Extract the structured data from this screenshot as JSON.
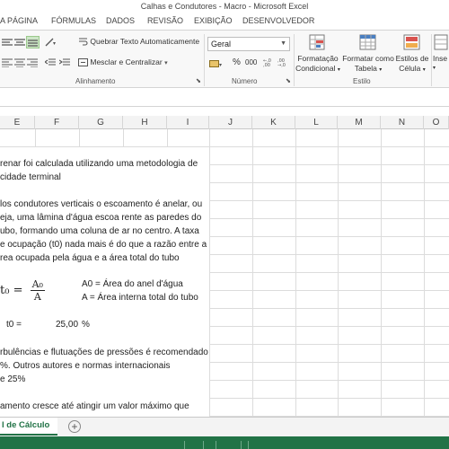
{
  "window": {
    "title": "Calhas e Condutores - Macro - Microsoft Excel"
  },
  "ribbon_tabs": [
    "A PÁGINA",
    "FÓRMULAS",
    "DADOS",
    "REVISÃO",
    "EXIBIÇÃO",
    "DESENVOLVEDOR"
  ],
  "ribbon": {
    "wrap_text_label": "Quebrar Texto Automaticamente",
    "merge_label": "Mesclar e Centralizar",
    "number_format_value": "Geral",
    "percent_symbol": "%",
    "thousands_symbol": "000",
    "conditional_format_label_1": "Formatação",
    "conditional_format_label_2": "Condicional",
    "format_table_label_1": "Formatar como",
    "format_table_label_2": "Tabela",
    "cell_styles_label_1": "Estilos de",
    "cell_styles_label_2": "Célula",
    "insert_label": "Inse",
    "group_alignment": "Alinhamento",
    "group_number": "Número",
    "group_style": "Estilo"
  },
  "columns": [
    "E",
    "F",
    "G",
    "H",
    "I",
    "J",
    "K",
    "L",
    "M",
    "N",
    "O"
  ],
  "cells": {
    "r1": "renar foi calculada utilizando uma metodologia de",
    "r2": "cidade terminal",
    "r3": "los condutores verticais o escoamento é anelar, ou",
    "r4": "eja, uma lâmina d'água escoa rente as paredes do",
    "r5": "ubo, formando uma coluna de ar no centro. A taxa",
    "r6": "e ocupação (t0) nada mais é do que a razão entre a",
    "r7": "rea ocupada pela água e a área total do tubo",
    "formula_lhs": "t₀ =",
    "formula_num": "A₀",
    "formula_den": "A",
    "def1": "A0 = Área do anel d'água",
    "def2": "A = Área interna total do tubo",
    "t0_label": "t0 =",
    "t0_value": "25,00",
    "t0_unit": "%",
    "r8": "rbulências e flutuações de pressões é recomendado",
    "r9": "%. Outros autores e normas internacionais",
    "r10": "e 25%",
    "r11": "amento cresce até atingir um valor máximo que"
  },
  "sheet_tab": "l de Cálculo",
  "add_sheet_symbol": "+"
}
